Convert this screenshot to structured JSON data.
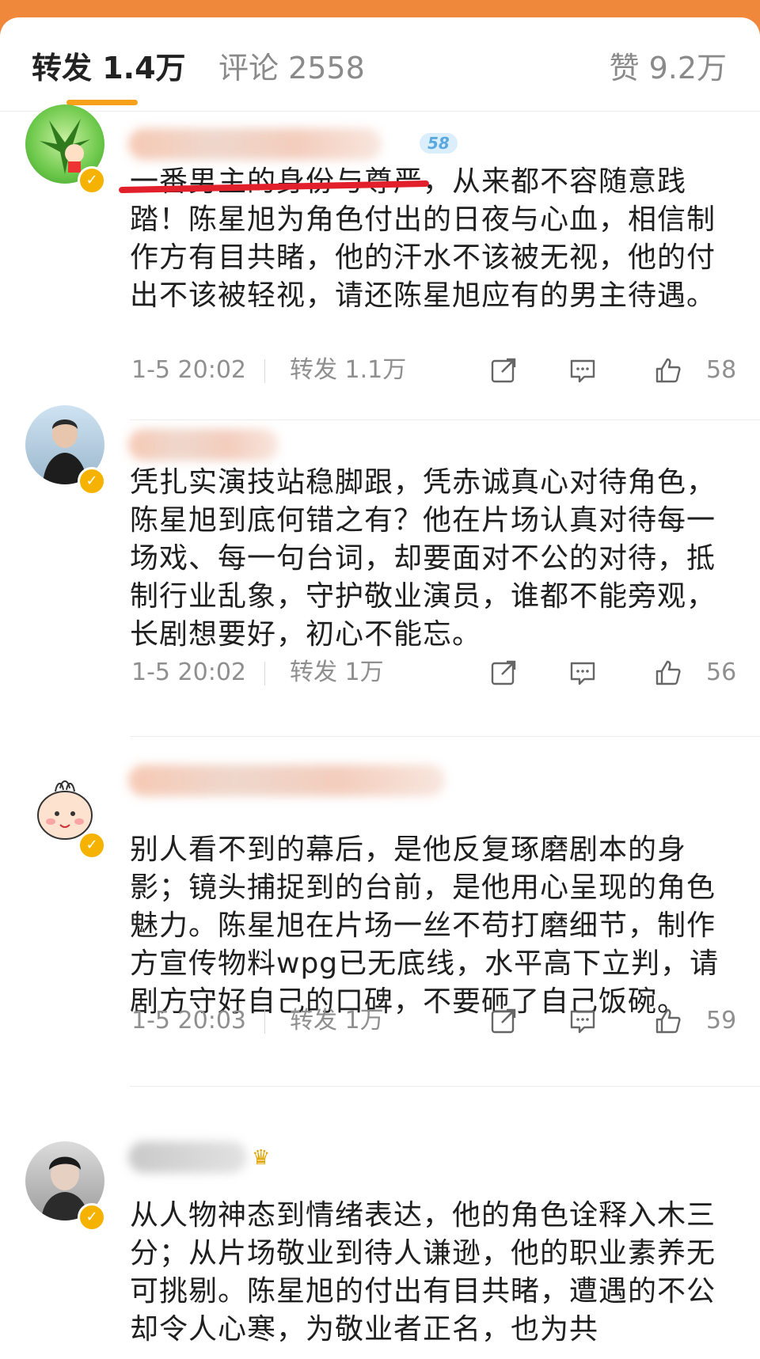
{
  "tabs": {
    "repost": "转发 1.4万",
    "comment": "评论 2558",
    "like": "赞 9.2万"
  },
  "comments": [
    {
      "level": "58",
      "text": "一番男主的身份与尊严，从来都不容随意践踏！陈星旭为角色付出的日夜与心血，相信制作方有目共睹，他的汗水不该被无视，他的付出不该被轻视，请还陈星旭应有的男主待遇。",
      "time": "1-5 20:02",
      "repost": "转发 1.1万",
      "likes": "58"
    },
    {
      "text": "凭扎实演技站稳脚跟，凭赤诚真心对待角色，陈星旭到底何错之有？他在片场认真对待每一场戏、每一句台词，却要面对不公的对待，抵制行业乱象，守护敬业演员，谁都不能旁观，长剧想要好，初心不能忘。",
      "time": "1-5 20:02",
      "repost": "转发 1万",
      "likes": "56"
    },
    {
      "text": "别人看不到的幕后，是他反复琢磨剧本的身影；镜头捕捉到的台前，是他用心呈现的角色魅力。陈星旭在片场一丝不苟打磨细节，制作方宣传物料wpg已无底线，水平高下立判，请剧方守好自己的口碑，不要砸了自己饭碗。",
      "time": "1-5 20:03",
      "repost": "转发 1万",
      "likes": "59"
    },
    {
      "text": "从人物神态到情绪表达，他的角色诠释入木三分；从片场敬业到待人谦逊，他的职业素养无可挑剔。陈星旭的付出有目共睹，遭遇的不公却令人心寒，为敬业者正名，也为共",
      "time": "",
      "repost": "",
      "likes": ""
    }
  ],
  "colors": {
    "accent": "#f7a11a",
    "header_orange": "#f0883c",
    "underline_red": "#e2202c",
    "text": "#1f1f1f",
    "muted": "#8f8f8f"
  },
  "icons": [
    "share-icon",
    "reply-icon",
    "thumbs-up-icon",
    "verified-badge-icon"
  ]
}
